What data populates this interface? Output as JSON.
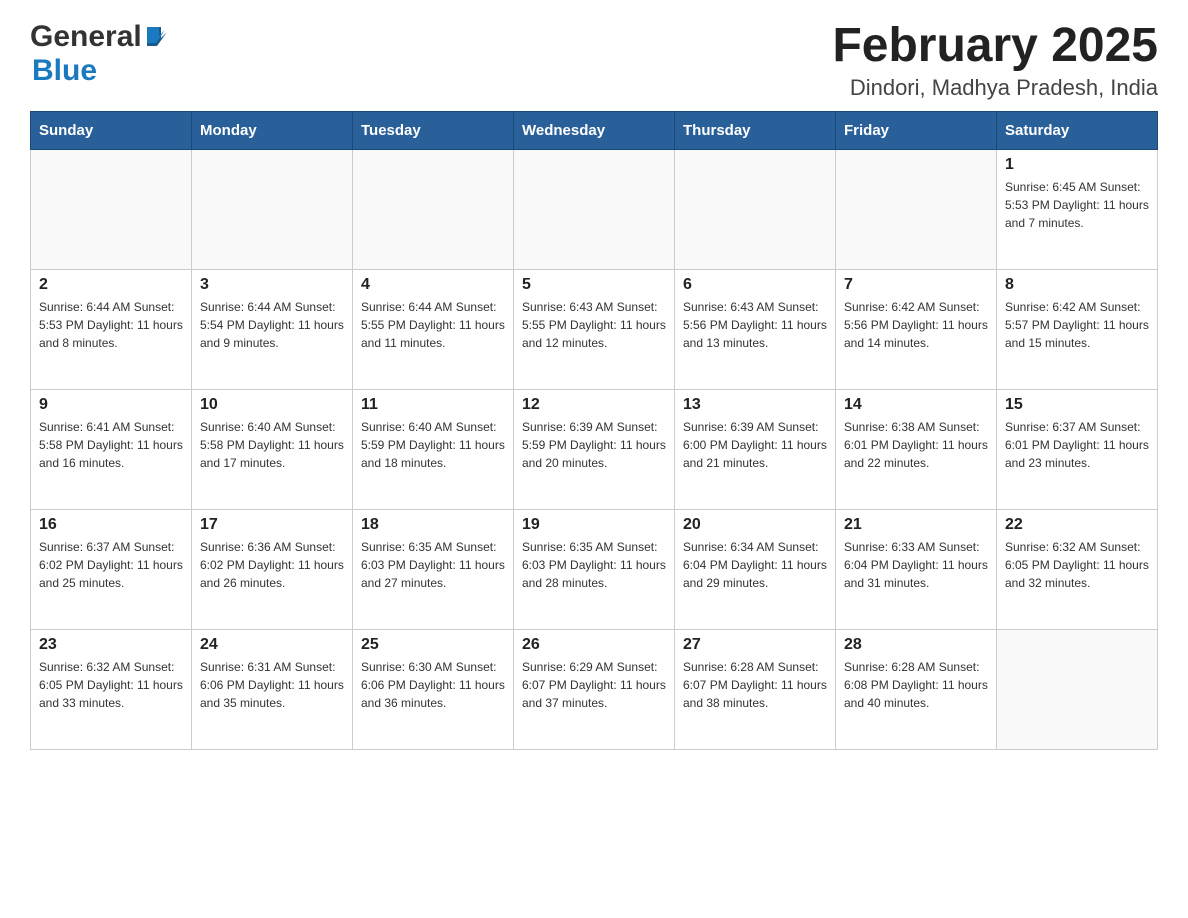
{
  "header": {
    "title": "February 2025",
    "subtitle": "Dindori, Madhya Pradesh, India",
    "logo_general": "General",
    "logo_blue": "Blue"
  },
  "days_of_week": [
    "Sunday",
    "Monday",
    "Tuesday",
    "Wednesday",
    "Thursday",
    "Friday",
    "Saturday"
  ],
  "weeks": [
    [
      {
        "day": "",
        "info": ""
      },
      {
        "day": "",
        "info": ""
      },
      {
        "day": "",
        "info": ""
      },
      {
        "day": "",
        "info": ""
      },
      {
        "day": "",
        "info": ""
      },
      {
        "day": "",
        "info": ""
      },
      {
        "day": "1",
        "info": "Sunrise: 6:45 AM\nSunset: 5:53 PM\nDaylight: 11 hours and 7 minutes."
      }
    ],
    [
      {
        "day": "2",
        "info": "Sunrise: 6:44 AM\nSunset: 5:53 PM\nDaylight: 11 hours and 8 minutes."
      },
      {
        "day": "3",
        "info": "Sunrise: 6:44 AM\nSunset: 5:54 PM\nDaylight: 11 hours and 9 minutes."
      },
      {
        "day": "4",
        "info": "Sunrise: 6:44 AM\nSunset: 5:55 PM\nDaylight: 11 hours and 11 minutes."
      },
      {
        "day": "5",
        "info": "Sunrise: 6:43 AM\nSunset: 5:55 PM\nDaylight: 11 hours and 12 minutes."
      },
      {
        "day": "6",
        "info": "Sunrise: 6:43 AM\nSunset: 5:56 PM\nDaylight: 11 hours and 13 minutes."
      },
      {
        "day": "7",
        "info": "Sunrise: 6:42 AM\nSunset: 5:56 PM\nDaylight: 11 hours and 14 minutes."
      },
      {
        "day": "8",
        "info": "Sunrise: 6:42 AM\nSunset: 5:57 PM\nDaylight: 11 hours and 15 minutes."
      }
    ],
    [
      {
        "day": "9",
        "info": "Sunrise: 6:41 AM\nSunset: 5:58 PM\nDaylight: 11 hours and 16 minutes."
      },
      {
        "day": "10",
        "info": "Sunrise: 6:40 AM\nSunset: 5:58 PM\nDaylight: 11 hours and 17 minutes."
      },
      {
        "day": "11",
        "info": "Sunrise: 6:40 AM\nSunset: 5:59 PM\nDaylight: 11 hours and 18 minutes."
      },
      {
        "day": "12",
        "info": "Sunrise: 6:39 AM\nSunset: 5:59 PM\nDaylight: 11 hours and 20 minutes."
      },
      {
        "day": "13",
        "info": "Sunrise: 6:39 AM\nSunset: 6:00 PM\nDaylight: 11 hours and 21 minutes."
      },
      {
        "day": "14",
        "info": "Sunrise: 6:38 AM\nSunset: 6:01 PM\nDaylight: 11 hours and 22 minutes."
      },
      {
        "day": "15",
        "info": "Sunrise: 6:37 AM\nSunset: 6:01 PM\nDaylight: 11 hours and 23 minutes."
      }
    ],
    [
      {
        "day": "16",
        "info": "Sunrise: 6:37 AM\nSunset: 6:02 PM\nDaylight: 11 hours and 25 minutes."
      },
      {
        "day": "17",
        "info": "Sunrise: 6:36 AM\nSunset: 6:02 PM\nDaylight: 11 hours and 26 minutes."
      },
      {
        "day": "18",
        "info": "Sunrise: 6:35 AM\nSunset: 6:03 PM\nDaylight: 11 hours and 27 minutes."
      },
      {
        "day": "19",
        "info": "Sunrise: 6:35 AM\nSunset: 6:03 PM\nDaylight: 11 hours and 28 minutes."
      },
      {
        "day": "20",
        "info": "Sunrise: 6:34 AM\nSunset: 6:04 PM\nDaylight: 11 hours and 29 minutes."
      },
      {
        "day": "21",
        "info": "Sunrise: 6:33 AM\nSunset: 6:04 PM\nDaylight: 11 hours and 31 minutes."
      },
      {
        "day": "22",
        "info": "Sunrise: 6:32 AM\nSunset: 6:05 PM\nDaylight: 11 hours and 32 minutes."
      }
    ],
    [
      {
        "day": "23",
        "info": "Sunrise: 6:32 AM\nSunset: 6:05 PM\nDaylight: 11 hours and 33 minutes."
      },
      {
        "day": "24",
        "info": "Sunrise: 6:31 AM\nSunset: 6:06 PM\nDaylight: 11 hours and 35 minutes."
      },
      {
        "day": "25",
        "info": "Sunrise: 6:30 AM\nSunset: 6:06 PM\nDaylight: 11 hours and 36 minutes."
      },
      {
        "day": "26",
        "info": "Sunrise: 6:29 AM\nSunset: 6:07 PM\nDaylight: 11 hours and 37 minutes."
      },
      {
        "day": "27",
        "info": "Sunrise: 6:28 AM\nSunset: 6:07 PM\nDaylight: 11 hours and 38 minutes."
      },
      {
        "day": "28",
        "info": "Sunrise: 6:28 AM\nSunset: 6:08 PM\nDaylight: 11 hours and 40 minutes."
      },
      {
        "day": "",
        "info": ""
      }
    ]
  ]
}
